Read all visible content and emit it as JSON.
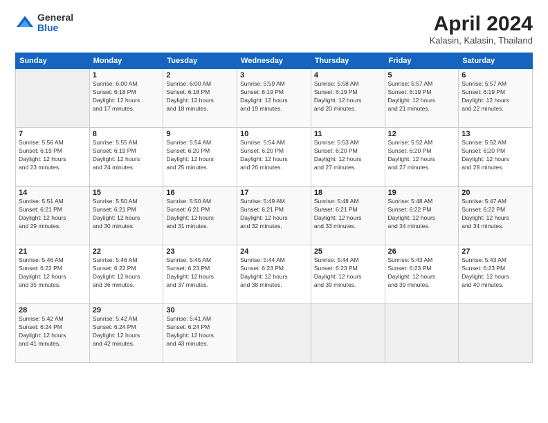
{
  "logo": {
    "general": "General",
    "blue": "Blue"
  },
  "title": "April 2024",
  "subtitle": "Kalasin, Kalasin, Thailand",
  "headers": [
    "Sunday",
    "Monday",
    "Tuesday",
    "Wednesday",
    "Thursday",
    "Friday",
    "Saturday"
  ],
  "weeks": [
    [
      {
        "day": "",
        "info": ""
      },
      {
        "day": "1",
        "info": "Sunrise: 6:00 AM\nSunset: 6:18 PM\nDaylight: 12 hours\nand 17 minutes."
      },
      {
        "day": "2",
        "info": "Sunrise: 6:00 AM\nSunset: 6:18 PM\nDaylight: 12 hours\nand 18 minutes."
      },
      {
        "day": "3",
        "info": "Sunrise: 5:59 AM\nSunset: 6:19 PM\nDaylight: 12 hours\nand 19 minutes."
      },
      {
        "day": "4",
        "info": "Sunrise: 5:58 AM\nSunset: 6:19 PM\nDaylight: 12 hours\nand 20 minutes."
      },
      {
        "day": "5",
        "info": "Sunrise: 5:57 AM\nSunset: 6:19 PM\nDaylight: 12 hours\nand 21 minutes."
      },
      {
        "day": "6",
        "info": "Sunrise: 5:57 AM\nSunset: 6:19 PM\nDaylight: 12 hours\nand 22 minutes."
      }
    ],
    [
      {
        "day": "7",
        "info": "Sunrise: 5:56 AM\nSunset: 6:19 PM\nDaylight: 12 hours\nand 23 minutes."
      },
      {
        "day": "8",
        "info": "Sunrise: 5:55 AM\nSunset: 6:19 PM\nDaylight: 12 hours\nand 24 minutes."
      },
      {
        "day": "9",
        "info": "Sunrise: 5:54 AM\nSunset: 6:20 PM\nDaylight: 12 hours\nand 25 minutes."
      },
      {
        "day": "10",
        "info": "Sunrise: 5:54 AM\nSunset: 6:20 PM\nDaylight: 12 hours\nand 26 minutes."
      },
      {
        "day": "11",
        "info": "Sunrise: 5:53 AM\nSunset: 6:20 PM\nDaylight: 12 hours\nand 27 minutes."
      },
      {
        "day": "12",
        "info": "Sunrise: 5:52 AM\nSunset: 6:20 PM\nDaylight: 12 hours\nand 27 minutes."
      },
      {
        "day": "13",
        "info": "Sunrise: 5:52 AM\nSunset: 6:20 PM\nDaylight: 12 hours\nand 28 minutes."
      }
    ],
    [
      {
        "day": "14",
        "info": "Sunrise: 5:51 AM\nSunset: 6:21 PM\nDaylight: 12 hours\nand 29 minutes."
      },
      {
        "day": "15",
        "info": "Sunrise: 5:50 AM\nSunset: 6:21 PM\nDaylight: 12 hours\nand 30 minutes."
      },
      {
        "day": "16",
        "info": "Sunrise: 5:50 AM\nSunset: 6:21 PM\nDaylight: 12 hours\nand 31 minutes."
      },
      {
        "day": "17",
        "info": "Sunrise: 5:49 AM\nSunset: 6:21 PM\nDaylight: 12 hours\nand 32 minutes."
      },
      {
        "day": "18",
        "info": "Sunrise: 5:48 AM\nSunset: 6:21 PM\nDaylight: 12 hours\nand 33 minutes."
      },
      {
        "day": "19",
        "info": "Sunrise: 5:48 AM\nSunset: 6:22 PM\nDaylight: 12 hours\nand 34 minutes."
      },
      {
        "day": "20",
        "info": "Sunrise: 5:47 AM\nSunset: 6:22 PM\nDaylight: 12 hours\nand 34 minutes."
      }
    ],
    [
      {
        "day": "21",
        "info": "Sunrise: 5:46 AM\nSunset: 6:22 PM\nDaylight: 12 hours\nand 35 minutes."
      },
      {
        "day": "22",
        "info": "Sunrise: 5:46 AM\nSunset: 6:22 PM\nDaylight: 12 hours\nand 36 minutes."
      },
      {
        "day": "23",
        "info": "Sunrise: 5:45 AM\nSunset: 6:23 PM\nDaylight: 12 hours\nand 37 minutes."
      },
      {
        "day": "24",
        "info": "Sunrise: 5:44 AM\nSunset: 6:23 PM\nDaylight: 12 hours\nand 38 minutes."
      },
      {
        "day": "25",
        "info": "Sunrise: 5:44 AM\nSunset: 6:23 PM\nDaylight: 12 hours\nand 39 minutes."
      },
      {
        "day": "26",
        "info": "Sunrise: 5:43 AM\nSunset: 6:23 PM\nDaylight: 12 hours\nand 39 minutes."
      },
      {
        "day": "27",
        "info": "Sunrise: 5:43 AM\nSunset: 6:23 PM\nDaylight: 12 hours\nand 40 minutes."
      }
    ],
    [
      {
        "day": "28",
        "info": "Sunrise: 5:42 AM\nSunset: 6:24 PM\nDaylight: 12 hours\nand 41 minutes."
      },
      {
        "day": "29",
        "info": "Sunrise: 5:42 AM\nSunset: 6:24 PM\nDaylight: 12 hours\nand 42 minutes."
      },
      {
        "day": "30",
        "info": "Sunrise: 5:41 AM\nSunset: 6:24 PM\nDaylight: 12 hours\nand 43 minutes."
      },
      {
        "day": "",
        "info": ""
      },
      {
        "day": "",
        "info": ""
      },
      {
        "day": "",
        "info": ""
      },
      {
        "day": "",
        "info": ""
      }
    ]
  ]
}
